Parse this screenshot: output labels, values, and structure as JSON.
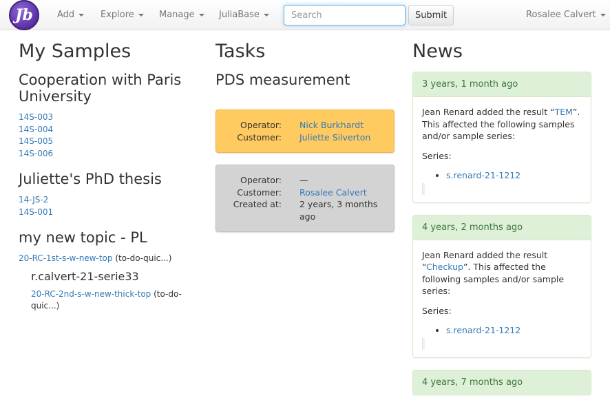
{
  "navbar": {
    "logo_text": "Jb",
    "menus": [
      {
        "label": "Add"
      },
      {
        "label": "Explore"
      },
      {
        "label": "Manage"
      },
      {
        "label": "JuliaBase"
      }
    ],
    "search_placeholder": "Search",
    "submit_label": "Submit",
    "user_name": "Rosalee Calvert"
  },
  "samples": {
    "title": "My Samples",
    "topics": [
      {
        "name": "Cooperation with Paris University",
        "samples": [
          "14S-003",
          "14S-004",
          "14S-005",
          "14S-006"
        ]
      },
      {
        "name": "Juliette's PhD thesis",
        "samples": [
          "14-JS-2",
          "14S-001"
        ]
      },
      {
        "name": "my new topic - PL",
        "samples": [
          {
            "name": "20-RC-1st-s-w-new-top",
            "note": "(to-do-quic...)"
          }
        ],
        "subtopic": {
          "name": "r.calvert-21-serie33",
          "samples": [
            {
              "name": "20-RC-2nd-s-w-new-thick-top",
              "note": "(to-do-quic...)"
            }
          ]
        }
      }
    ]
  },
  "tasks": {
    "title": "Tasks",
    "process": "PDS measurement",
    "items": [
      {
        "operator_label": "Operator:",
        "operator": "Nick Burkhardt",
        "customer_label": "Customer:",
        "customer": "Juliette Silverton",
        "color": "#ffca60"
      },
      {
        "operator_label": "Operator:",
        "operator": "—",
        "customer_label": "Customer:",
        "customer": "Rosalee Calvert",
        "created_label": "Created at:",
        "created": "2 years, 3 months ago",
        "color": "#d3d3d3"
      }
    ]
  },
  "news": {
    "title": "News",
    "items": [
      {
        "time": "3 years, 1 month ago",
        "prefix": "Jean Renard added the result “",
        "result": "TEM",
        "suffix": "”. This affected the following samples and/or sample series:",
        "series_label": "Series:",
        "series": [
          "s.renard-21-1212"
        ]
      },
      {
        "time": "4 years, 2 months ago",
        "prefix": "Jean Renard added the result “",
        "result": "Checkup",
        "suffix": "”. This affected the following samples and/or sample series:",
        "series_label": "Series:",
        "series": [
          "s.renard-21-1212"
        ]
      },
      {
        "time": "4 years, 7 months ago"
      }
    ]
  },
  "colors": {
    "link": "#337ab7",
    "news_header": "#dff0d8",
    "news_text": "#3c763d"
  }
}
